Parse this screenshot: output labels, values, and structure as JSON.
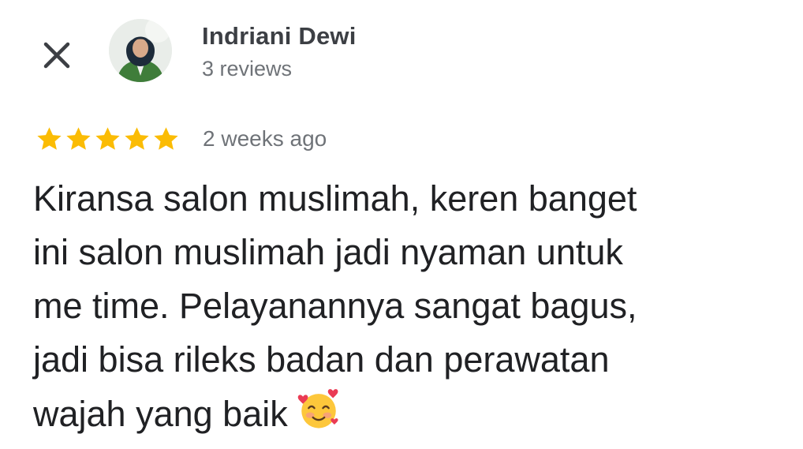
{
  "reviewer": {
    "name": "Indriani Dewi",
    "meta": "3 reviews"
  },
  "review": {
    "rating": 5,
    "rating_max": 5,
    "date": "2 weeks ago",
    "lines": [
      "Kiransa salon muslimah, keren banget",
      "ini salon muslimah jadi nyaman untuk",
      "me time. Pelayanannya sangat bagus,",
      "jadi bisa rileks badan dan perawatan",
      "wajah yang baik"
    ],
    "emoji": "smiling-face-with-hearts"
  },
  "icons": {
    "close": "close-icon",
    "star": "star-icon",
    "avatar": "avatar"
  },
  "colors": {
    "star": "#fbbc04",
    "name_text": "#3c3f44",
    "meta_text": "#6f7378",
    "body_text": "#202124",
    "background": "#ffffff"
  }
}
